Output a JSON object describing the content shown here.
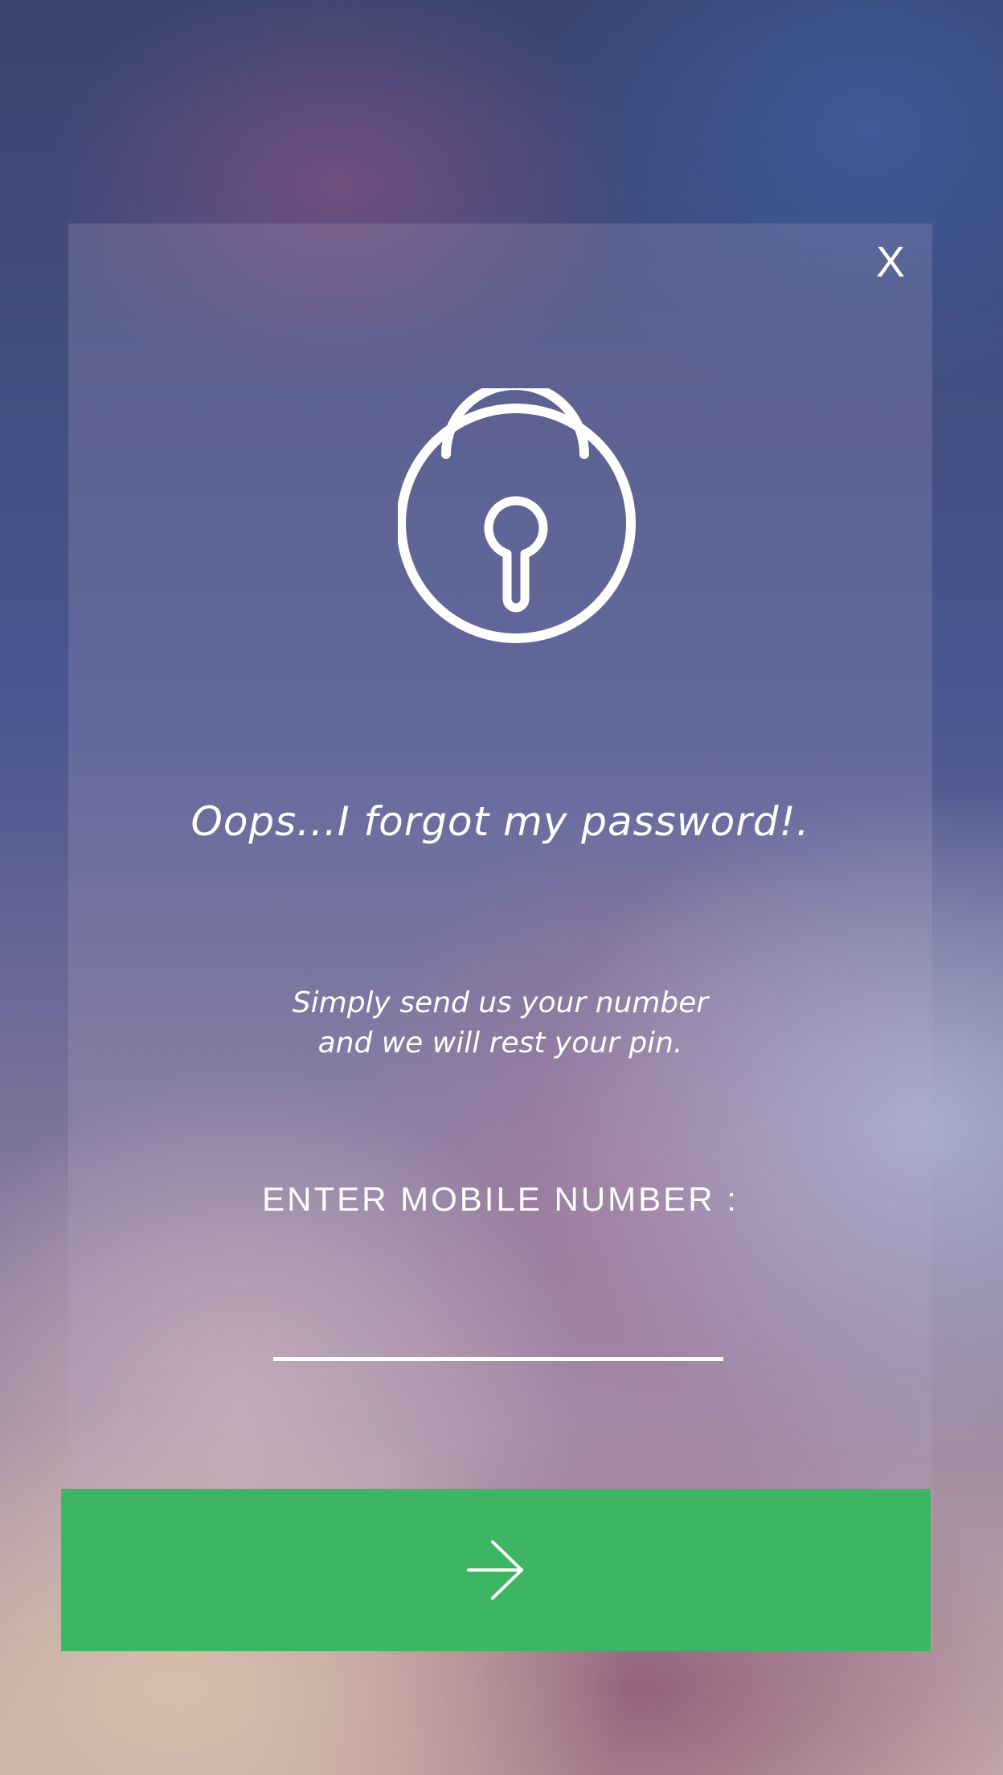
{
  "dialog": {
    "close_label": "X",
    "title": "Oops...I forgot my password!.",
    "subtitle_line1": "Simply send us your number",
    "subtitle_line2": "and we will rest your pin.",
    "field_label": "ENTER MOBILE NUMBER :",
    "mobile_value": "",
    "submit_icon": "arrow-right-icon",
    "lock_icon": "padlock-icon"
  },
  "colors": {
    "accent": "#3db664",
    "text": "#ffffff"
  }
}
